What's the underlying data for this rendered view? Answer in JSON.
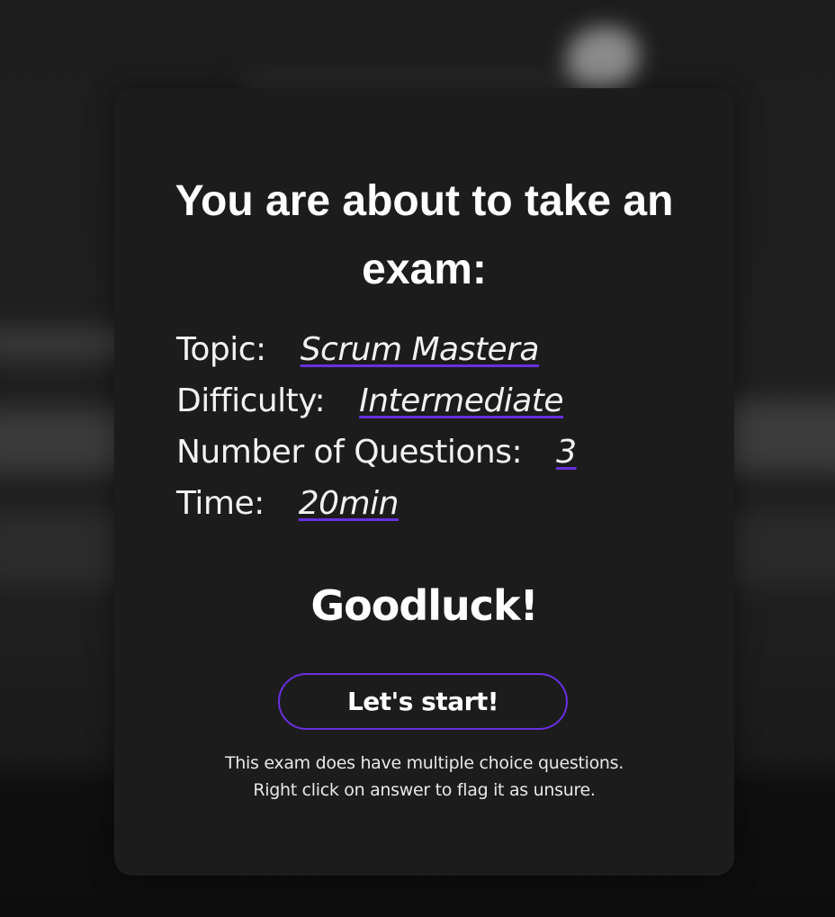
{
  "heading": "You are about to take an exam:",
  "details": [
    {
      "label": "Topic:",
      "value": "Scrum Mastera"
    },
    {
      "label": "Difficulty:",
      "value": "Intermediate"
    },
    {
      "label": "Number of Questions:",
      "value": "3"
    },
    {
      "label": "Time:",
      "value": "20min"
    }
  ],
  "closing": "Goodluck!",
  "start_button_label": "Let's start!",
  "note_lines": [
    "This exam does have multiple choice questions.",
    "Right click on answer to flag it as unsure."
  ],
  "colors": {
    "accent": "#6a2fe0",
    "card_background": "#1c1c1d",
    "text": "#ffffff"
  }
}
